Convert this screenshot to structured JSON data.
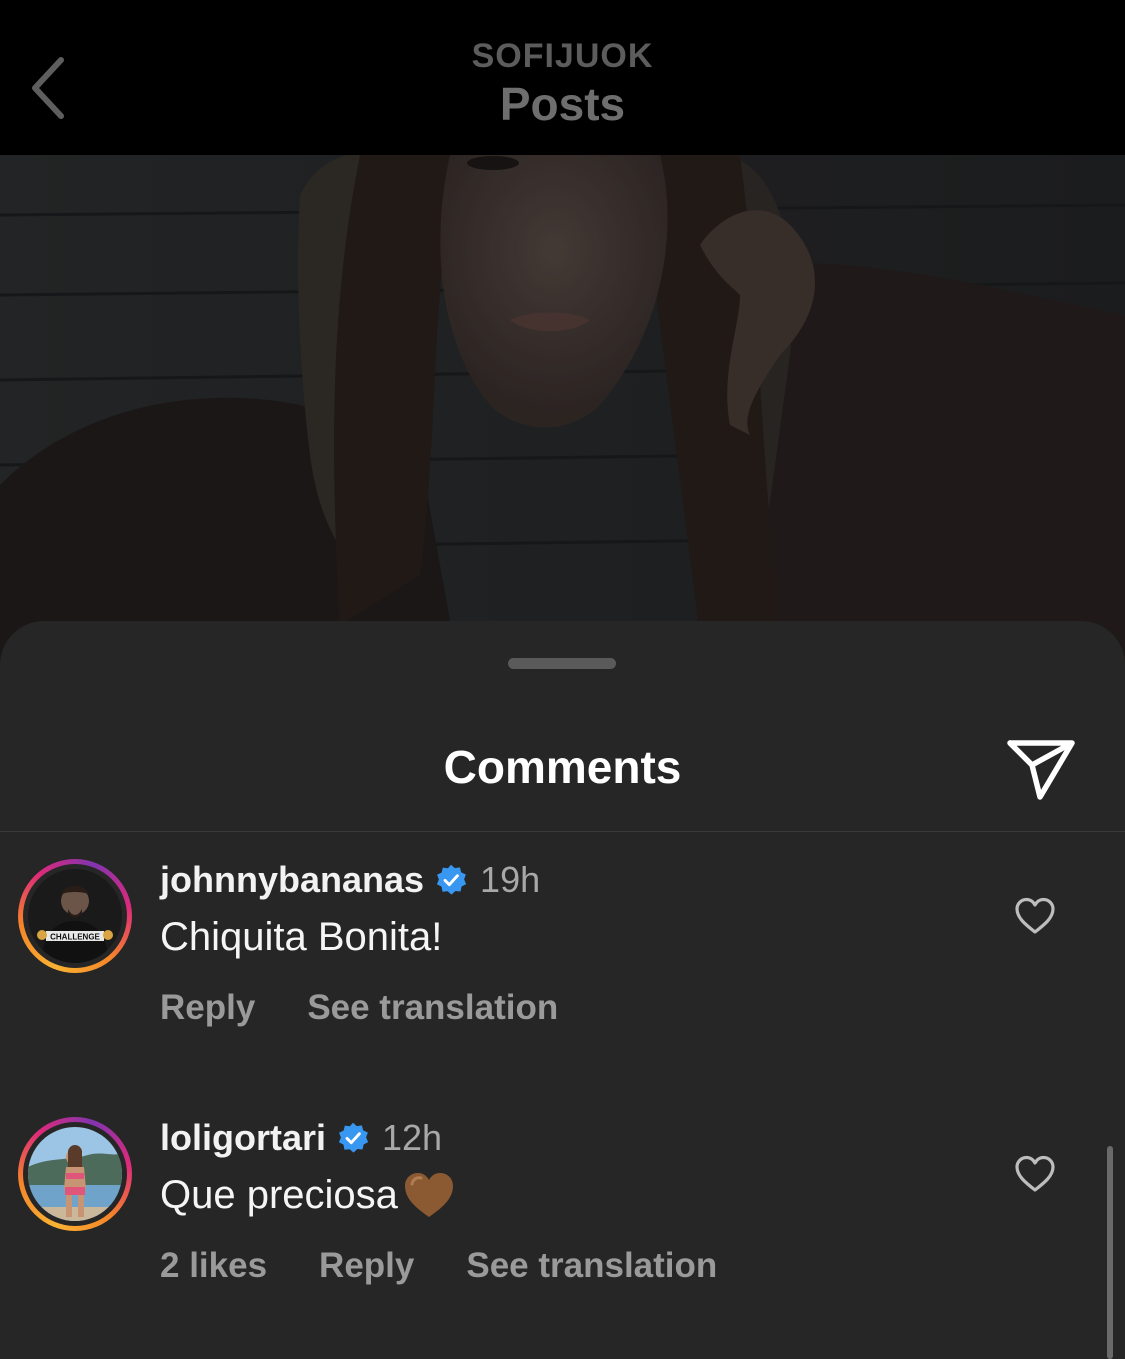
{
  "header": {
    "username": "SOFIJUOK",
    "title": "Posts"
  },
  "sheet": {
    "title": "Comments"
  },
  "comments": [
    {
      "username": "johnnybananas",
      "verified": true,
      "time": "19h",
      "text": "Chiquita Bonita!",
      "likes": "",
      "reply_label": "Reply",
      "translate_label": "See translation",
      "avatar_caption": "CHALLENGE"
    },
    {
      "username": "loligortari",
      "verified": true,
      "time": "12h",
      "text": "Que preciosa",
      "emoji": "brown-heart",
      "likes": "2 likes",
      "reply_label": "Reply",
      "translate_label": "See translation"
    }
  ],
  "colors": {
    "background": "#000000",
    "sheet": "#262626",
    "verified_blue": "#3897f0",
    "ring_gradient": [
      "#f9b233",
      "#f58529",
      "#dd2a7b",
      "#8134af"
    ],
    "brown_heart": "#8b5a33"
  },
  "icons": {
    "back": "chevron-left-icon",
    "share": "paper-plane-icon",
    "like": "heart-outline-icon",
    "verified": "verified-badge-icon"
  }
}
